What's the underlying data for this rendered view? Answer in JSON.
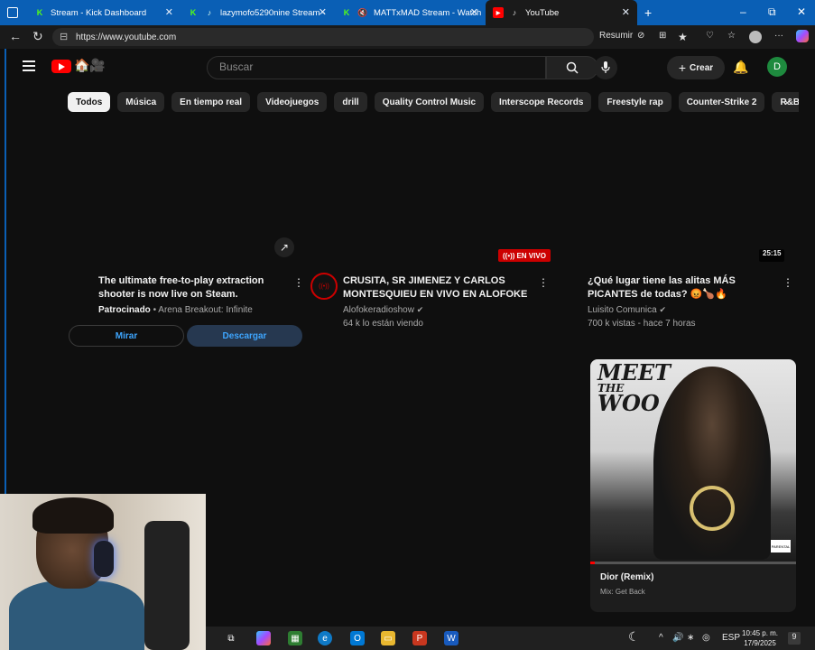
{
  "browser": {
    "tabs": [
      {
        "label": "Stream - Kick Dashboard",
        "icon": "kick-icon"
      },
      {
        "label": "lazymofo5290nine Stream -",
        "icon": "kick-icon"
      },
      {
        "label": "MATTxMAD Stream - Watch",
        "icon": "kick-icon"
      },
      {
        "label": "YouTube",
        "icon": "youtube-icon"
      }
    ],
    "new_tab": "+",
    "url": "https://www.youtube.com",
    "resume_label": "Resumir",
    "window_controls": {
      "minimize": "–",
      "maximize": "⧉",
      "close": "✕"
    }
  },
  "youtube": {
    "search_placeholder": "Buscar",
    "create_label": "Crear",
    "avatar_letter": "D",
    "chips": [
      "Todos",
      "Música",
      "En tiempo real",
      "Videojuegos",
      "drill",
      "Quality Control Music",
      "Interscope Records",
      "Freestyle rap",
      "Counter-Strike 2",
      "R&B conte"
    ]
  },
  "ad": {
    "title": "The ultimate free-to-play extraction shooter is now live on Steam.",
    "sponsored": "Patrocinado",
    "advertiser": "• Arena Breakout: Infinite",
    "watch_button": "Mirar",
    "download_button": "Descargar"
  },
  "live_video": {
    "badge": "EN VIVO",
    "title": "CRUSITA, SR JIMENEZ Y CARLOS MONTESQUIEU EN VIVO EN ALOFOKE",
    "channel": "Alofokeradioshow",
    "viewers": "64 k lo están viendo"
  },
  "video3": {
    "duration": "25:15",
    "title": "¿Qué lugar tiene las alitas MÁS PICANTES de todas? 😡🍗🔥",
    "channel": "Luisito Comunica",
    "meta": "700 k vistas - hace 7 horas"
  },
  "mix": {
    "art_text_line1": "MEET",
    "art_text_line2": "THE",
    "art_text_line3": "WOO",
    "title": "Dior (Remix)",
    "subtitle": "Mix: Get Back",
    "progress": 0.02
  },
  "taskbar": {
    "language": "ESP",
    "time": "10:45 p. m.",
    "date": "17/9/2025",
    "notifications": "9"
  }
}
